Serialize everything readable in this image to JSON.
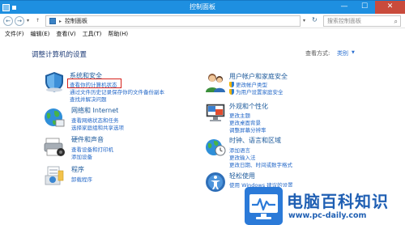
{
  "window": {
    "title": "控制面板",
    "min_glyph": "—",
    "max_glyph": "☐",
    "close_glyph": "✕"
  },
  "address": {
    "back": "←",
    "forward": "→",
    "history": "▾",
    "up": "↑",
    "separator": "▸",
    "path": "控制面板",
    "dropdown": "▾",
    "refresh": "↻",
    "search_placeholder": "搜索控制面板",
    "search_icon": "⌕"
  },
  "menu": [
    "文件(F)",
    "编辑(E)",
    "查看(V)",
    "工具(T)",
    "帮助(H)"
  ],
  "main": {
    "heading": "调整计算机的设置",
    "view_by_label": "查看方式:",
    "view_by_value": "类别",
    "view_by_arrow": "▼"
  },
  "categories": {
    "system_security": {
      "title": "系统和安全",
      "links": [
        "查看你的计算机状态",
        "通过文件历史记录保存你的文件备份副本",
        "查找并解决问题"
      ]
    },
    "network": {
      "title": "网络和 Internet",
      "links": [
        "查看网络状态和任务",
        "选择家庭组和共享选项"
      ]
    },
    "hardware": {
      "title": "硬件和声音",
      "links": [
        "查看设备和打印机",
        "添加设备"
      ]
    },
    "programs": {
      "title": "程序",
      "links": [
        "卸载程序"
      ]
    },
    "user_accounts": {
      "title": "用户帐户和家庭安全",
      "links": [
        "更改帐户类型",
        "为用户设置家庭安全"
      ]
    },
    "appearance": {
      "title": "外观和个性化",
      "links": [
        "更改主题",
        "更改桌面背景",
        "调整屏幕分辨率"
      ]
    },
    "clock_region": {
      "title": "时钟、语言和区域",
      "links": [
        "添加语言",
        "更改输入法",
        "更改日期、时间或数字格式"
      ]
    },
    "ease_access": {
      "title": "轻松使用",
      "links": [
        "使用 Windows 建议的设置"
      ]
    }
  },
  "watermark": {
    "title": "电脑百科知识",
    "url": "www.pc-daily.com"
  },
  "colors": {
    "titlebar": "#1e8fe0",
    "link": "#2468c8",
    "highlight": "#d6221c"
  }
}
